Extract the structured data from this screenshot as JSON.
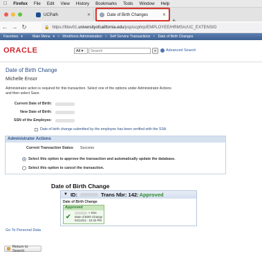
{
  "mac_menu": {
    "app": "Firefox",
    "items": [
      "File",
      "Edit",
      "View",
      "History",
      "Bookmarks",
      "Tools",
      "Window",
      "Help"
    ]
  },
  "tabs": [
    {
      "title": "UCPath",
      "active": false
    },
    {
      "title": "Date of Birth Changes",
      "active": true
    }
  ],
  "url": {
    "prefix": "https://fdev01.",
    "domain": "universityofcalifornia.edu",
    "path": "/psp/ucphrp/EMPLOYEE/HRMS/c/UC_EXTENSIO"
  },
  "ps_nav": {
    "favorites": "Favorites",
    "main_menu": "Main Menu",
    "crumb1": "Workforce Administration",
    "crumb2": "Self Service Transactions",
    "crumb3": "Date of Birth Changes",
    "sep": ">"
  },
  "header": {
    "logo": "ORACLE",
    "scope": "All",
    "search_placeholder": "Search",
    "go": "»",
    "advanced_search": "Advanced Search"
  },
  "page": {
    "title": "Date of Birth Change",
    "employee_name": "Michelle Ensor",
    "instructions": "Administrator action is required for this transaction. Select one of the options under Administrator Actions and then select Save.",
    "fields": {
      "current_dob": "Current Date of Birth:",
      "new_dob": "New Date of Birth:",
      "ssn": "SSN of the Employee:"
    },
    "verified_label": "Date of birth change submitted by the employee has been verified with the SSA"
  },
  "admin": {
    "title": "Administrator Actions",
    "status_label": "Current Transaction Status",
    "status_value": "Success",
    "option_approve": "Select this option to approve the transaction and automatically update the database.",
    "option_cancel": "Select this option to cancel the transaction."
  },
  "approval": {
    "heading": "Date of Birth Change",
    "id_label": "ID:",
    "trans_label": "Trans Nbr: 142:",
    "status": "Approved",
    "subheading": "Date of Birth Change",
    "step_status": "Approved",
    "step_extra": "» Disc",
    "step_name": "Date of Birth Change",
    "step_date": "04/14/21 - 10:42 PM"
  },
  "links": {
    "personal_data": "Go To Personal Data",
    "return_search": "Return to Search"
  },
  "colors": {
    "oracle_red": "#d2262f",
    "ps_blue": "#3d5f91",
    "approved_green": "#2e8b2e",
    "highlight_red": "#d9322b"
  }
}
